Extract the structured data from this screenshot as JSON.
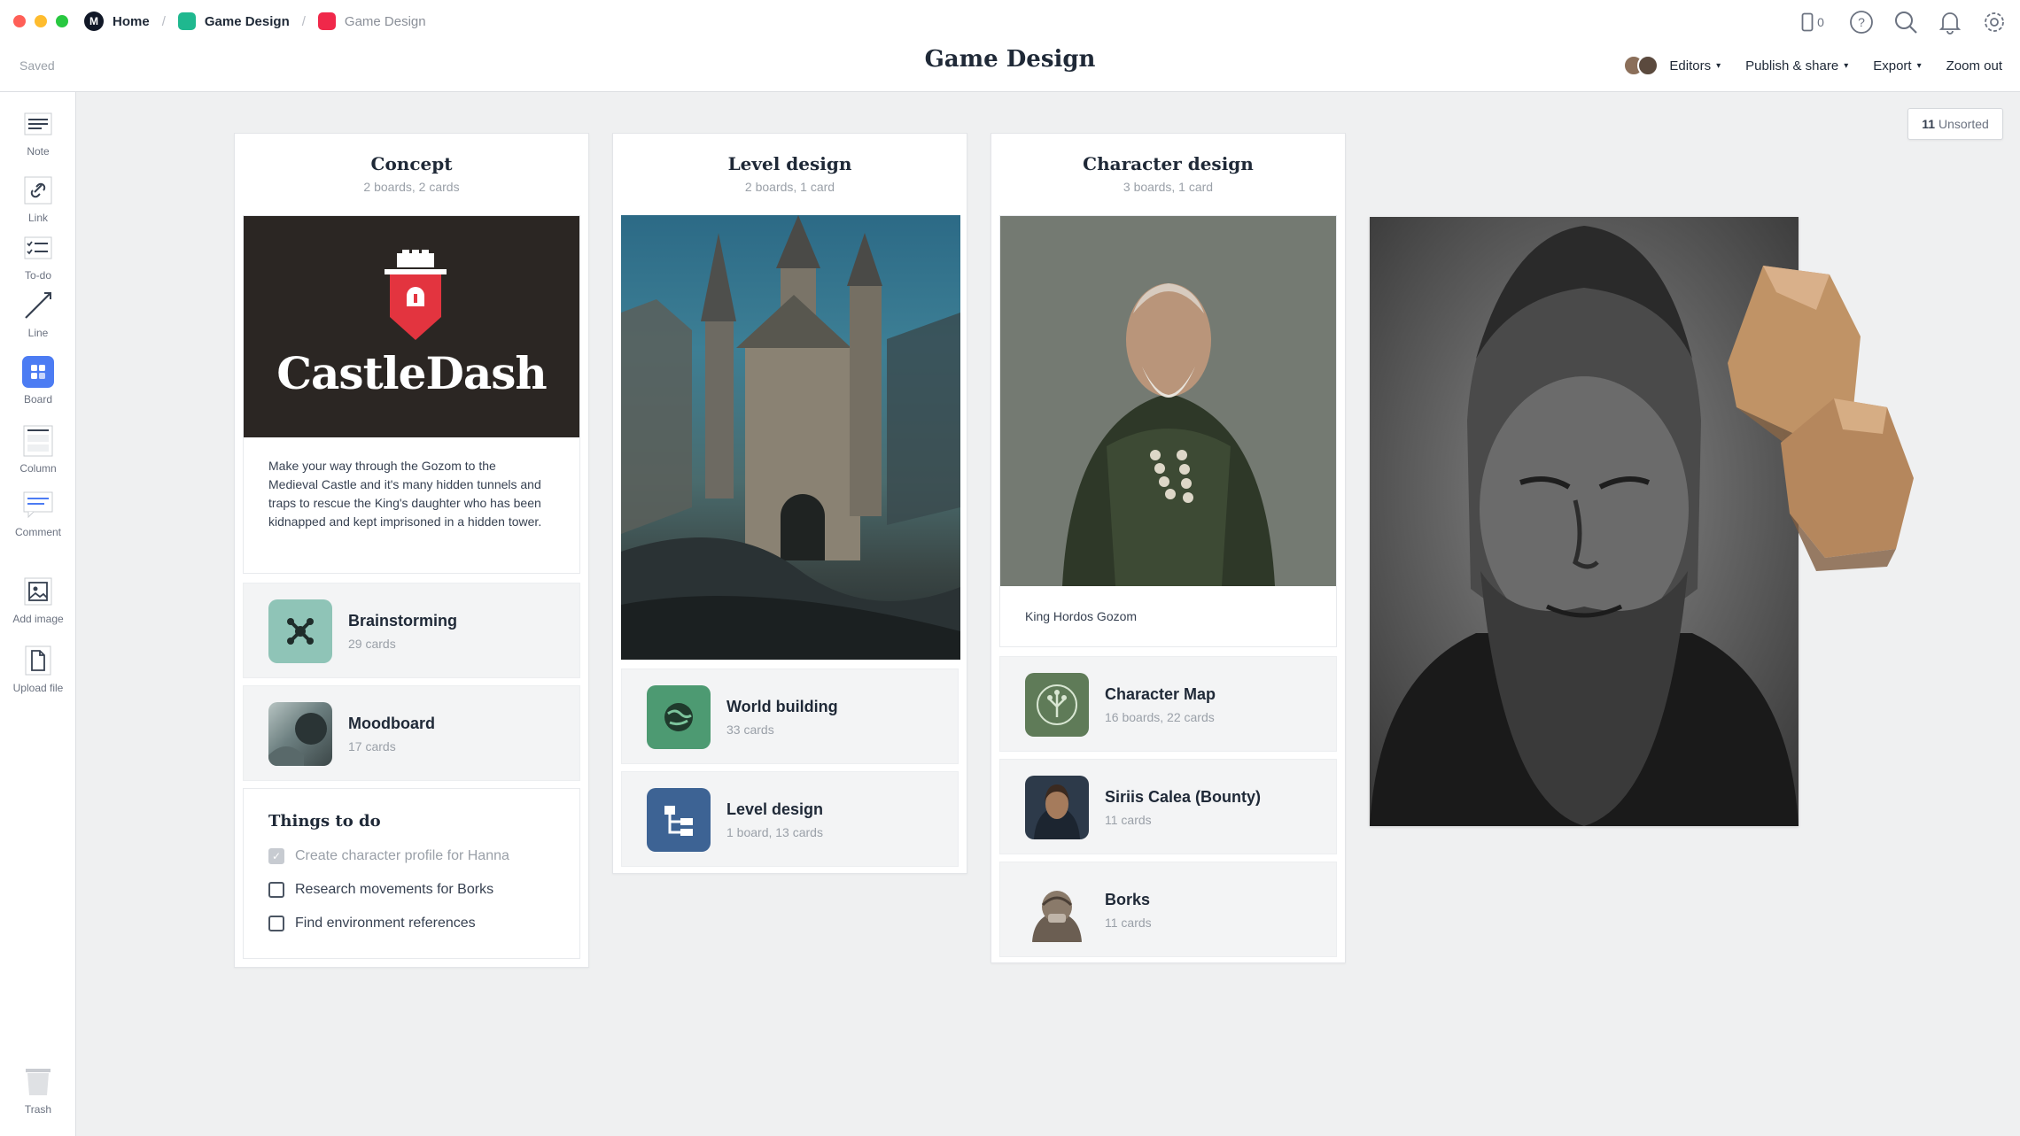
{
  "window": {
    "traffic_colors": [
      "#ff5f57",
      "#febc2e",
      "#28c840"
    ]
  },
  "breadcrumb": [
    {
      "label": "Home",
      "icon": "milanote-logo-icon"
    },
    {
      "label": "Game Design",
      "icon": "board-icon",
      "color": "#1fb88f"
    },
    {
      "label": "Game Design",
      "icon": "board-icon",
      "color": "#f0284a"
    }
  ],
  "status": {
    "saved": "Saved"
  },
  "title": "Game Design",
  "top_icons": {
    "device_count": "0"
  },
  "toolbar": {
    "editors": "Editors",
    "publish": "Publish & share",
    "export": "Export",
    "zoom": "Zoom out"
  },
  "tools": [
    {
      "label": "Note",
      "icon": "note-icon"
    },
    {
      "label": "Link",
      "icon": "link-icon"
    },
    {
      "label": "To-do",
      "icon": "todo-icon"
    },
    {
      "label": "Line",
      "icon": "line-icon"
    },
    {
      "label": "Board",
      "icon": "board-icon"
    },
    {
      "label": "Column",
      "icon": "column-icon"
    },
    {
      "label": "Comment",
      "icon": "comment-icon"
    },
    {
      "label": "Add image",
      "icon": "image-icon"
    },
    {
      "label": "Upload file",
      "icon": "file-icon"
    },
    {
      "label": "Trash",
      "icon": "trash-icon"
    }
  ],
  "unsorted": {
    "count": "11",
    "label": "Unsorted"
  },
  "columns": {
    "concept": {
      "title": "Concept",
      "sub": "2 boards, 2 cards",
      "logo": "CastleDash",
      "description": "Make your way through the Gozom to the Medieval Castle and it's many hidden tunnels and traps to rescue the King's daughter who has been kidnapped and kept imprisoned in a hidden tower.",
      "boards": [
        {
          "title": "Brainstorming",
          "sub": "29 cards",
          "color": "#8fc4b7"
        },
        {
          "title": "Moodboard",
          "sub": "17 cards",
          "color": "#4a5a5c"
        }
      ],
      "todo": {
        "title": "Things to do",
        "items": [
          {
            "text": "Create character profile for Hanna",
            "done": true
          },
          {
            "text": "Research movements for Borks",
            "done": false
          },
          {
            "text": "Find environment references",
            "done": false
          }
        ]
      }
    },
    "level": {
      "title": "Level design",
      "sub": "2 boards, 1 card",
      "boards": [
        {
          "title": "World building",
          "sub": "33 cards",
          "color": "#4d9a72"
        },
        {
          "title": "Level design",
          "sub": "1 board, 13 cards",
          "color": "#3d6394"
        }
      ]
    },
    "character": {
      "title": "Character design",
      "sub": "3 boards, 1 card",
      "caption": "King Hordos Gozom",
      "boards": [
        {
          "title": "Character Map",
          "sub": "16 boards, 22 cards",
          "color": "#5f7b58"
        },
        {
          "title": "Siriis Calea (Bounty)",
          "sub": "11 cards",
          "color": "#2d3a4a"
        },
        {
          "title": "Borks",
          "sub": "11 cards",
          "color": "#8a7a6a"
        }
      ]
    }
  }
}
